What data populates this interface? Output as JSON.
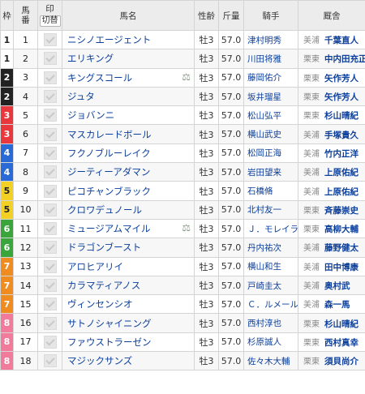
{
  "header": {
    "waku": "枠",
    "umaban_1": "馬",
    "umaban_2": "番",
    "mark_1": "印",
    "mark_btn": "切替",
    "horse_name": "馬名",
    "sex_age": "性齢",
    "weight": "斤量",
    "jockey": "騎手",
    "trainer": "厩舎"
  },
  "waku_colors": {
    "1": {
      "bg": "#ffffff",
      "fg": "#222222"
    },
    "2": {
      "bg": "#222222",
      "fg": "#ffffff"
    },
    "3": {
      "bg": "#e8383d",
      "fg": "#ffffff"
    },
    "4": {
      "bg": "#2a6ad6",
      "fg": "#ffffff"
    },
    "5": {
      "bg": "#f2d024",
      "fg": "#222222"
    },
    "6": {
      "bg": "#3aa53a",
      "fg": "#ffffff"
    },
    "7": {
      "bg": "#f08c1f",
      "fg": "#ffffff"
    },
    "8": {
      "bg": "#f27a9a",
      "fg": "#ffffff"
    }
  },
  "rows": [
    {
      "waku": "1",
      "umaban": "1",
      "name": "ニシノエージェント",
      "icon": false,
      "sex": "牡3",
      "kin": "57.0",
      "jockey": "津村明秀",
      "area": "美浦",
      "trainer": "千葉直人"
    },
    {
      "waku": "1",
      "umaban": "2",
      "name": "エリキング",
      "icon": false,
      "sex": "牡3",
      "kin": "57.0",
      "jockey": "川田将雅",
      "area": "栗東",
      "trainer": "中内田充正"
    },
    {
      "waku": "2",
      "umaban": "3",
      "name": "キングスコール",
      "icon": true,
      "sex": "牡3",
      "kin": "57.0",
      "jockey": "藤岡佑介",
      "area": "栗東",
      "trainer": "矢作芳人"
    },
    {
      "waku": "2",
      "umaban": "4",
      "name": "ジュタ",
      "icon": false,
      "sex": "牡3",
      "kin": "57.0",
      "jockey": "坂井瑠星",
      "area": "栗東",
      "trainer": "矢作芳人"
    },
    {
      "waku": "3",
      "umaban": "5",
      "name": "ジョバンニ",
      "icon": false,
      "sex": "牡3",
      "kin": "57.0",
      "jockey": "松山弘平",
      "area": "栗東",
      "trainer": "杉山晴紀"
    },
    {
      "waku": "3",
      "umaban": "6",
      "name": "マスカレードボール",
      "icon": false,
      "sex": "牡3",
      "kin": "57.0",
      "jockey": "横山武史",
      "area": "美浦",
      "trainer": "手塚貴久"
    },
    {
      "waku": "4",
      "umaban": "7",
      "name": "フクノブルーレイク",
      "icon": false,
      "sex": "牡3",
      "kin": "57.0",
      "jockey": "松岡正海",
      "area": "美浦",
      "trainer": "竹内正洋"
    },
    {
      "waku": "4",
      "umaban": "8",
      "name": "ジーティーアダマン",
      "icon": false,
      "sex": "牡3",
      "kin": "57.0",
      "jockey": "岩田望来",
      "area": "美浦",
      "trainer": "上原佑紀"
    },
    {
      "waku": "5",
      "umaban": "9",
      "name": "ピコチャンブラック",
      "icon": false,
      "sex": "牡3",
      "kin": "57.0",
      "jockey": "石橋脩",
      "area": "美浦",
      "trainer": "上原佑紀"
    },
    {
      "waku": "5",
      "umaban": "10",
      "name": "クロワデュノール",
      "icon": false,
      "sex": "牡3",
      "kin": "57.0",
      "jockey": "北村友一",
      "area": "栗東",
      "trainer": "斉藤崇史"
    },
    {
      "waku": "6",
      "umaban": "11",
      "name": "ミュージアムマイル",
      "icon": true,
      "sex": "牡3",
      "kin": "57.0",
      "jockey": "Ｊ．モレイラ",
      "area": "栗東",
      "trainer": "高柳大輔"
    },
    {
      "waku": "6",
      "umaban": "12",
      "name": "ドラゴンブースト",
      "icon": false,
      "sex": "牡3",
      "kin": "57.0",
      "jockey": "丹内祐次",
      "area": "美浦",
      "trainer": "藤野健太"
    },
    {
      "waku": "7",
      "umaban": "13",
      "name": "アロヒアリイ",
      "icon": false,
      "sex": "牡3",
      "kin": "57.0",
      "jockey": "横山和生",
      "area": "美浦",
      "trainer": "田中博康"
    },
    {
      "waku": "7",
      "umaban": "14",
      "name": "カラマティアノス",
      "icon": false,
      "sex": "牡3",
      "kin": "57.0",
      "jockey": "戸崎圭太",
      "area": "美浦",
      "trainer": "奥村武"
    },
    {
      "waku": "7",
      "umaban": "15",
      "name": "ヴィンセンシオ",
      "icon": false,
      "sex": "牡3",
      "kin": "57.0",
      "jockey": "Ｃ．ルメール",
      "area": "美浦",
      "trainer": "森一馬"
    },
    {
      "waku": "8",
      "umaban": "16",
      "name": "サトノシャイニング",
      "icon": false,
      "sex": "牡3",
      "kin": "57.0",
      "jockey": "西村淳也",
      "area": "栗東",
      "trainer": "杉山晴紀"
    },
    {
      "waku": "8",
      "umaban": "17",
      "name": "ファウストラーゼン",
      "icon": false,
      "sex": "牡3",
      "kin": "57.0",
      "jockey": "杉原誠人",
      "area": "栗東",
      "trainer": "西村真幸"
    },
    {
      "waku": "8",
      "umaban": "18",
      "name": "マジックサンズ",
      "icon": false,
      "sex": "牡3",
      "kin": "57.0",
      "jockey": "佐々木大輔",
      "area": "栗東",
      "trainer": "須貝尚介"
    }
  ]
}
